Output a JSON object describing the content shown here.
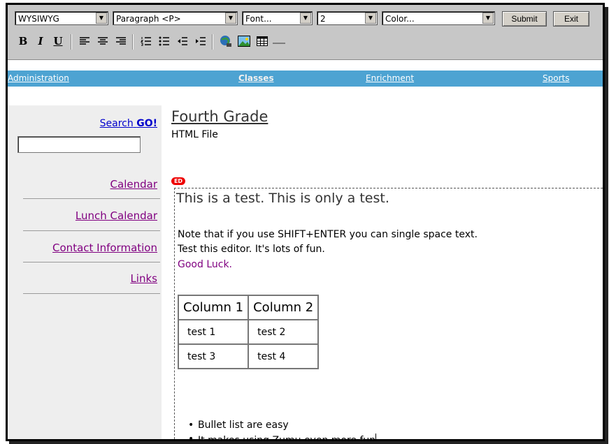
{
  "toolbar": {
    "mode_select": "WYSIWYG",
    "format_select": "Paragraph <P>",
    "font_select": "Font...",
    "size_select": "2",
    "color_select": "Color...",
    "submit_label": "Submit",
    "exit_label": "Exit",
    "bold": "B",
    "italic": "I",
    "underline": "U"
  },
  "nav": {
    "items": [
      "Administration",
      "Classes",
      "Enrichment",
      "Sports"
    ]
  },
  "sidebar": {
    "search_label": "Search",
    "go_label": "GO!",
    "links": [
      "Calendar",
      "Lunch Calendar",
      "Contact Information",
      "Links"
    ]
  },
  "page": {
    "title": "Fourth Grade",
    "subtitle": "HTML File",
    "ed_badge": "ED"
  },
  "editor": {
    "heading": "This is a test. This is only a test.",
    "line1": "Note that if you use SHIFT+ENTER you can single space text.",
    "line2": "Test this editor. It's lots of fun.",
    "line3": "Good Luck.",
    "table": {
      "headers": [
        "Column 1",
        "Column 2"
      ],
      "rows": [
        [
          "test 1",
          "test 2"
        ],
        [
          "test 3",
          "test 4"
        ]
      ]
    },
    "bullets": [
      "Bullet list are easy",
      "It makes using Zumu even more fun"
    ]
  },
  "colors": {
    "nav_bar": "#4da3d2",
    "toolbar": "#c7c7c7",
    "sidebar": "#eeeeee",
    "visited_link": "#800080",
    "link": "#0000cc"
  }
}
